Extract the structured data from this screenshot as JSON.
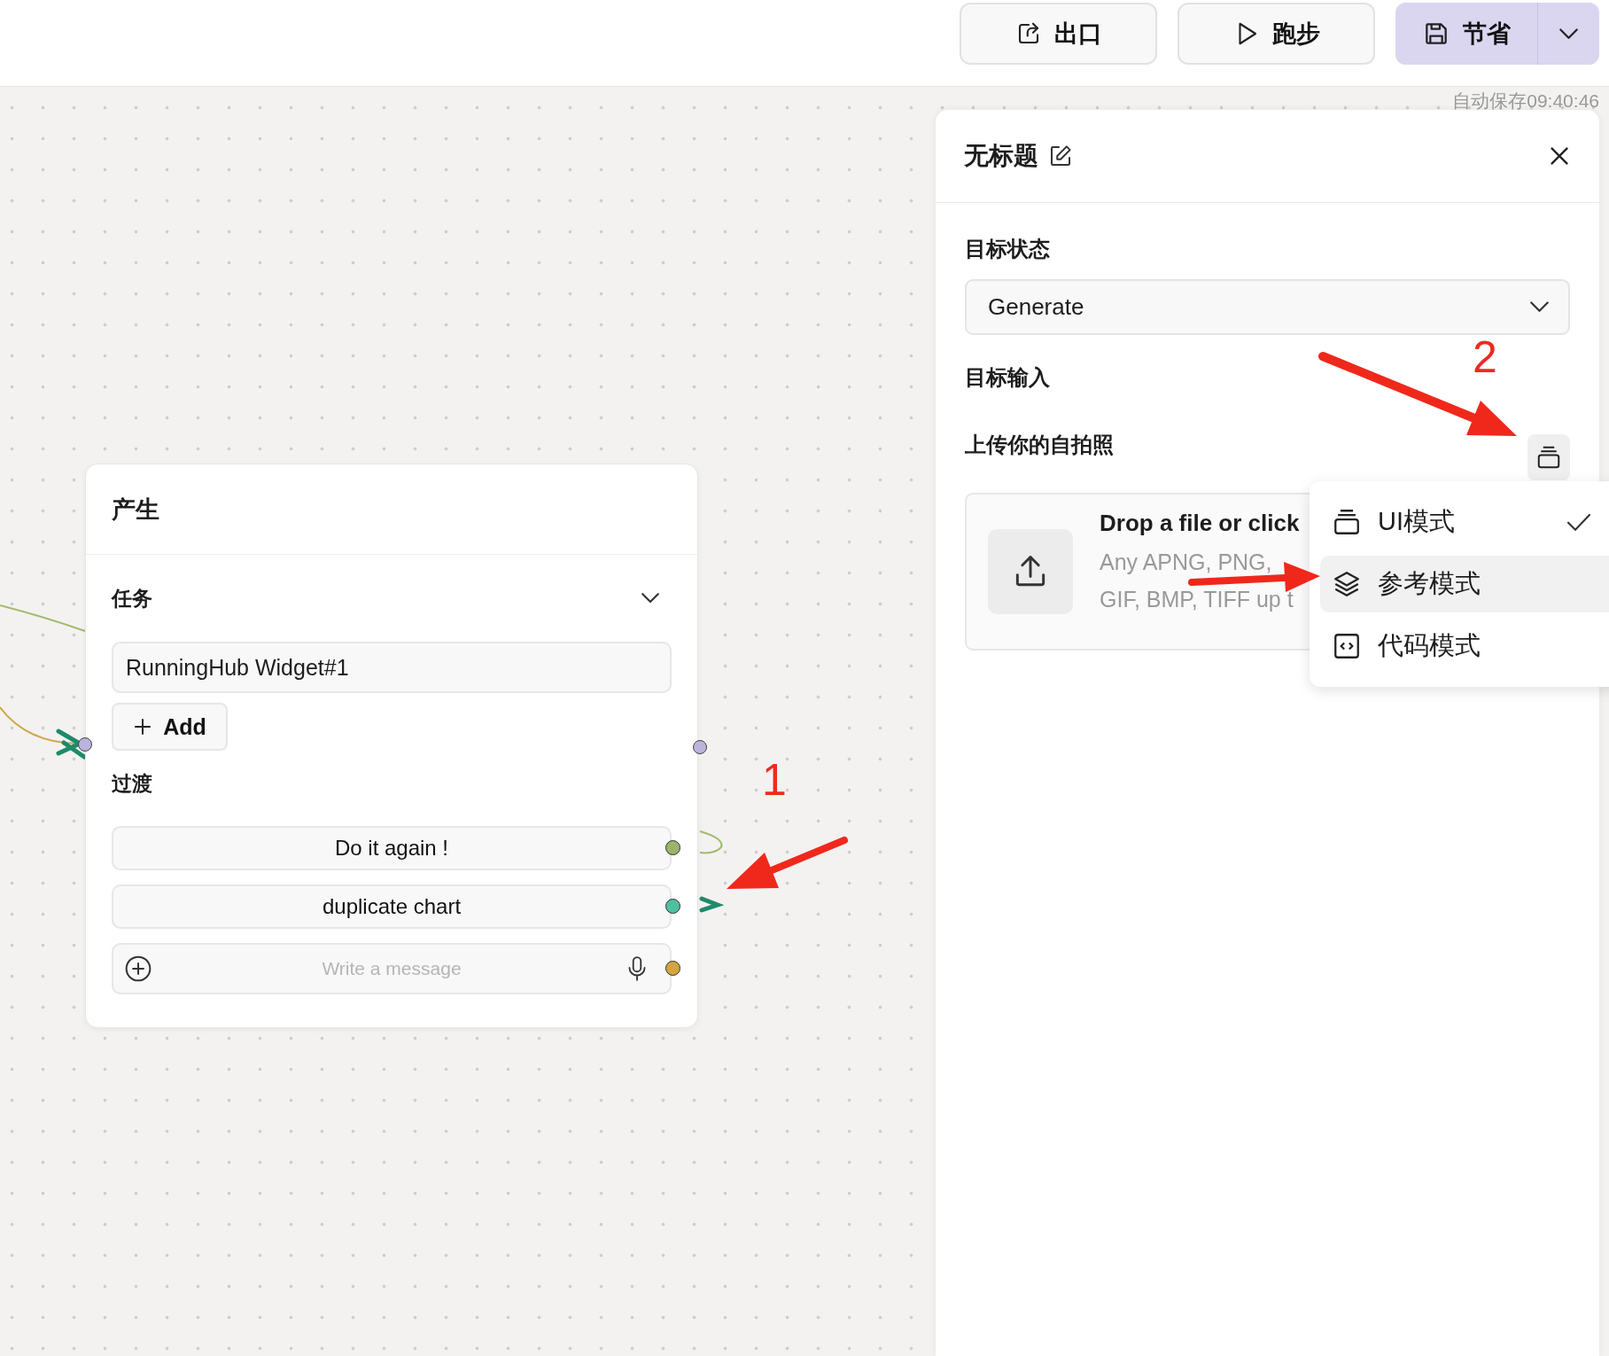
{
  "toolbar": {
    "buttons": [
      {
        "label": "出口",
        "kind": "export"
      },
      {
        "label": "跑步",
        "kind": "run"
      },
      {
        "label": "节省",
        "kind": "save"
      }
    ]
  },
  "autosave": "自动保存09:40:46",
  "node": {
    "title": "产生",
    "task_label": "任务",
    "tasks": [
      "RunningHub Widget#1"
    ],
    "add_label": "Add",
    "transition_label": "过渡",
    "transitions": [
      {
        "label": "Do it again !",
        "color": "#9cb36a"
      },
      {
        "label": "duplicate chart",
        "color": "#4fc0a0"
      }
    ],
    "message": {
      "placeholder": "Write a message",
      "color": "#d4a540"
    }
  },
  "panel": {
    "title": "无标题",
    "state_label": "目标状态",
    "state_value": "Generate",
    "input_label": "目标输入",
    "upload_label": "上传你的自拍照",
    "upload": {
      "title": "Drop a file or click",
      "hint_lines": [
        "Any APNG, PNG,",
        "GIF, BMP, TIFF up t"
      ]
    }
  },
  "mode_menu": {
    "items": [
      {
        "label": "UI模式",
        "kind": "ui",
        "checked": true,
        "selected": false
      },
      {
        "label": "参考模式",
        "kind": "reference",
        "checked": false,
        "selected": true
      },
      {
        "label": "代码模式",
        "kind": "code",
        "checked": false,
        "selected": false
      }
    ]
  },
  "annotations": [
    "1",
    "2"
  ]
}
